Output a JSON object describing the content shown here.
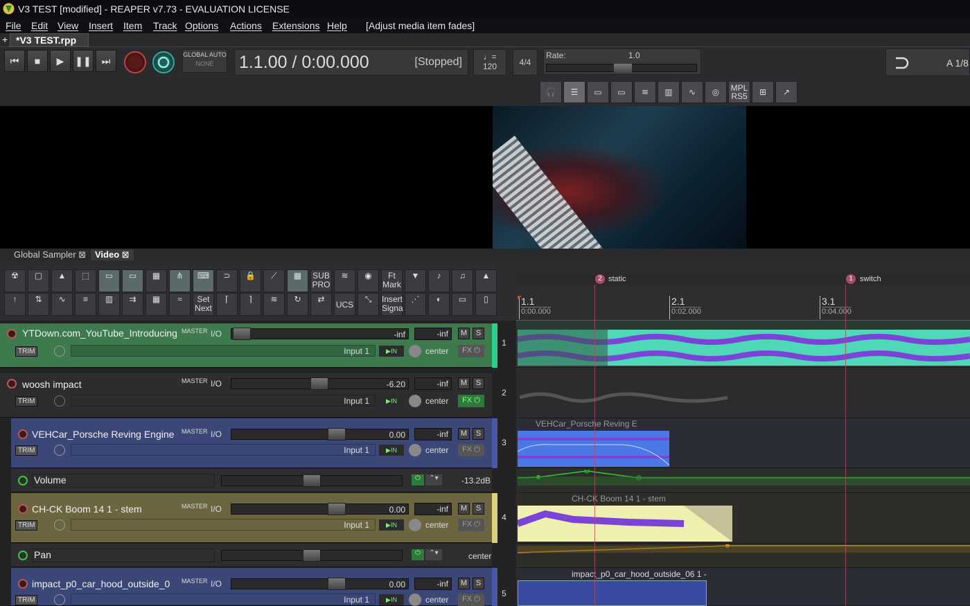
{
  "window": {
    "title": "V3 TEST [modified] - REAPER v7.73 - EVALUATION LICENSE"
  },
  "menu": {
    "items": [
      "File",
      "Edit",
      "View",
      "Insert",
      "Item",
      "Track",
      "Options",
      "Actions",
      "Extensions",
      "Help"
    ],
    "status": "[Adjust media item fades]"
  },
  "project_tab": {
    "label": "*V3 TEST.rpp",
    "add": "+"
  },
  "transport": {
    "global_auto": "GLOBAL AUTO",
    "auto_mode": "NONE",
    "position": "1.1.00 / 0:00.000",
    "state": "[Stopped]",
    "tempo_symbol": "♩=",
    "tempo": "120",
    "timesig": "4/4",
    "rate_label": "Rate:",
    "rate_value": "1.0",
    "right_label": "A 1/8"
  },
  "toolbar2": {
    "mpl_line1": "MPL",
    "mpl_line2": "RS5"
  },
  "dock": {
    "tabs": [
      "Global Sampler",
      "Video"
    ]
  },
  "tcp_toolbar": {
    "sub_pro": [
      "SUB",
      "PRO"
    ],
    "ft_mark": [
      "Ft",
      "Mark"
    ],
    "set_next": [
      "Set",
      "Next"
    ],
    "ucs": "UCS",
    "insert_signa": [
      "Insert",
      "Signa"
    ]
  },
  "ruler": {
    "markers": [
      {
        "num": "2",
        "name": "static"
      },
      {
        "num": "1",
        "name": "switch"
      }
    ],
    "ticks": [
      {
        "bar": "1.1",
        "time": "0:00.000"
      },
      {
        "bar": "2.1",
        "time": "0:02.000"
      },
      {
        "bar": "3.1",
        "time": "0:04.000"
      }
    ]
  },
  "tracks": [
    {
      "num": "1",
      "name": "YTDown.com_YouTube_Introducing",
      "master": "MASTER",
      "io": "I/O",
      "vol": "-inf",
      "peak": "-inf",
      "input": "Input 1",
      "pan": "center",
      "trim": "TRIM",
      "color": "#3d7a4e"
    },
    {
      "num": "2",
      "name": "woosh impact",
      "master": "MASTER",
      "io": "I/O",
      "vol": "-6.20",
      "peak": "-inf",
      "input": "Input 1",
      "pan": "center",
      "trim": "TRIM",
      "color": "#2d2d30"
    },
    {
      "num": "3",
      "name": "VEHCar_Porsche Reving Engine",
      "master": "MASTER",
      "io": "I/O",
      "vol": "0.00",
      "peak": "-inf",
      "input": "Input 1",
      "pan": "center",
      "trim": "TRIM",
      "color": "#3b4877"
    },
    {
      "num": "4",
      "name": "CH-CK Boom 14 1 - stem",
      "master": "MASTER",
      "io": "I/O",
      "vol": "0.00",
      "peak": "-inf",
      "input": "Input 1",
      "pan": "center",
      "trim": "TRIM",
      "color": "#6b6540"
    },
    {
      "num": "5",
      "name": "impact_p0_car_hood_outside_0",
      "master": "MASTER",
      "io": "I/O",
      "vol": "0.00",
      "peak": "-inf",
      "input": "Input 1",
      "pan": "center",
      "trim": "TRIM",
      "color": "#3b4877"
    }
  ],
  "envelopes": [
    {
      "name": "Volume",
      "value": "-13.2dB"
    },
    {
      "name": "Pan",
      "value": "center"
    }
  ],
  "items": [
    {
      "label": "VEHCar_Porsche Reving E"
    },
    {
      "label": "CH-CK Boom 14 1 - stem"
    },
    {
      "label": "impact_p0_car_hood_outside_06 1 -"
    }
  ],
  "colors": {
    "accent_green": "#2ecf8a",
    "marker": "#a84c63",
    "waveform_purple": "#7a44d8"
  }
}
